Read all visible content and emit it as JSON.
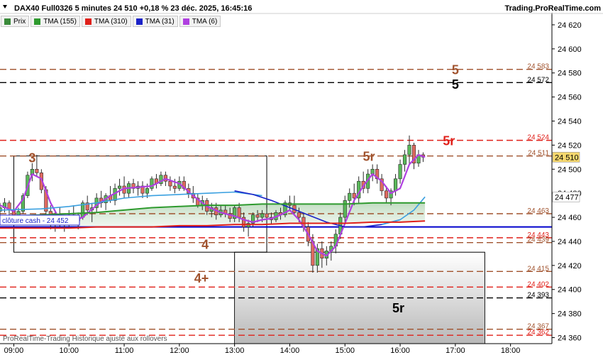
{
  "header": {
    "title": "DAX40 Full0326 5 minutes 24 510 +0,18 % 23 déc. 2025, 16:45:16",
    "brand": "Trading.ProRealTime.com"
  },
  "legend": [
    {
      "label": "Prix",
      "color": "#3a8a3a"
    },
    {
      "label": "TMA (155)",
      "color": "#2e9a2e"
    },
    {
      "label": "TMA (310)",
      "color": "#e0201a"
    },
    {
      "label": "TMA (31)",
      "color": "#1a22c8"
    },
    {
      "label": "TMA (6)",
      "color": "#b040e0"
    }
  ],
  "footer": "ProRealTime-Trading Historique ajusté aux rollovers",
  "cloture": {
    "label": "clôture cash -",
    "value": "24 452"
  },
  "chart_data": {
    "type": "candlestick",
    "ylim": [
      24355,
      24630
    ],
    "xlim": [
      "08:45",
      "18:45"
    ],
    "y_ticks": [
      24360,
      24380,
      24400,
      24420,
      24440,
      24460,
      24480,
      24500,
      24520,
      24540,
      24560,
      24580,
      24600,
      24620
    ],
    "y_tick_labels": [
      "24 360",
      "24 380",
      "24 400",
      "24 420",
      "24 440",
      "24 460",
      "24 480",
      "24 500",
      "24 520",
      "24 540",
      "24 560",
      "24 580",
      "24 600",
      "24 620"
    ],
    "x_ticks": [
      "09:00",
      "10:00",
      "11:00",
      "12:00",
      "13:00",
      "14:00",
      "15:00",
      "16:00",
      "17:00",
      "18:00"
    ],
    "levels": [
      {
        "value": 24583,
        "label": "24 583",
        "color": "#a0522d",
        "style": "dash"
      },
      {
        "value": 24572,
        "label": "24 572",
        "color": "#000000",
        "style": "dash"
      },
      {
        "value": 24524,
        "label": "24 524",
        "color": "#e0201a",
        "style": "dash"
      },
      {
        "value": 24511,
        "label": "24 511",
        "color": "#a0522d",
        "style": "dash"
      },
      {
        "value": 24463,
        "label": "24 463",
        "color": "#a0522d",
        "style": "dash"
      },
      {
        "value": 24452,
        "label": "",
        "color": "#0000cc",
        "style": "solid"
      },
      {
        "value": 24443,
        "label": "24 443",
        "color": "#e0201a",
        "style": "dash"
      },
      {
        "value": 24439,
        "label": "24 439",
        "color": "#a0522d",
        "style": "dash"
      },
      {
        "value": 24415,
        "label": "24 415",
        "color": "#a0522d",
        "style": "dash"
      },
      {
        "value": 24402,
        "label": "24 402",
        "color": "#e0201a",
        "style": "dash"
      },
      {
        "value": 24393,
        "label": "24 393",
        "color": "#000000",
        "style": "dash"
      },
      {
        "value": 24367,
        "label": "24 367",
        "color": "#a0522d",
        "style": "dash"
      },
      {
        "value": 24362,
        "label": "24 362",
        "color": "#e0201a",
        "style": "dash"
      }
    ],
    "price_tags": [
      {
        "value": 24510,
        "label": "24 510",
        "bg": "#f5d76e",
        "color": "#000000"
      },
      {
        "value": 24477,
        "label": "24 477",
        "bg": "#ffffff",
        "color": "#3aa0e0"
      }
    ],
    "annotations": [
      {
        "text": "5",
        "time": "17:00",
        "value": 24583,
        "color": "#a0522d"
      },
      {
        "text": "5",
        "time": "17:00",
        "value": 24571,
        "color": "#000000"
      },
      {
        "text": "5r",
        "time": "16:53",
        "value": 24524,
        "color": "#e0201a"
      },
      {
        "text": "5r",
        "time": "15:26",
        "value": 24511,
        "color": "#a0522d"
      },
      {
        "text": "3",
        "time": "09:20",
        "value": 24510,
        "color": "#a0522d"
      },
      {
        "text": "4",
        "time": "12:28",
        "value": 24438,
        "color": "#a0522d"
      },
      {
        "text": "4+",
        "time": "12:24",
        "value": 24410,
        "color": "#a0522d"
      },
      {
        "text": "5r",
        "time": "15:58",
        "value": 24385,
        "color": "#000000"
      }
    ],
    "boxes": [
      {
        "t1": "09:00",
        "t2": "13:35",
        "v1": 24511,
        "v2": 24431
      },
      {
        "t1": "13:00",
        "t2": "17:32",
        "v1": 24431,
        "v2": 24355
      }
    ],
    "candles": [
      {
        "t": "08:45",
        "o": 24465,
        "h": 24472,
        "l": 24460,
        "c": 24468
      },
      {
        "t": "08:50",
        "o": 24468,
        "h": 24476,
        "l": 24464,
        "c": 24472
      },
      {
        "t": "08:55",
        "o": 24472,
        "h": 24474,
        "l": 24462,
        "c": 24466
      },
      {
        "t": "09:00",
        "o": 24466,
        "h": 24470,
        "l": 24458,
        "c": 24460
      },
      {
        "t": "09:05",
        "o": 24460,
        "h": 24468,
        "l": 24456,
        "c": 24465
      },
      {
        "t": "09:10",
        "o": 24465,
        "h": 24480,
        "l": 24463,
        "c": 24478
      },
      {
        "t": "09:15",
        "o": 24478,
        "h": 24498,
        "l": 24476,
        "c": 24495
      },
      {
        "t": "09:20",
        "o": 24495,
        "h": 24505,
        "l": 24490,
        "c": 24500
      },
      {
        "t": "09:25",
        "o": 24500,
        "h": 24512,
        "l": 24494,
        "c": 24497
      },
      {
        "t": "09:30",
        "o": 24497,
        "h": 24500,
        "l": 24480,
        "c": 24483
      },
      {
        "t": "09:35",
        "o": 24483,
        "h": 24486,
        "l": 24462,
        "c": 24465
      },
      {
        "t": "09:40",
        "o": 24465,
        "h": 24470,
        "l": 24450,
        "c": 24455
      },
      {
        "t": "09:45",
        "o": 24455,
        "h": 24466,
        "l": 24448,
        "c": 24462
      },
      {
        "t": "09:50",
        "o": 24462,
        "h": 24468,
        "l": 24452,
        "c": 24456
      },
      {
        "t": "09:55",
        "o": 24456,
        "h": 24462,
        "l": 24448,
        "c": 24458
      },
      {
        "t": "10:00",
        "o": 24458,
        "h": 24466,
        "l": 24452,
        "c": 24462
      },
      {
        "t": "10:05",
        "o": 24462,
        "h": 24470,
        "l": 24454,
        "c": 24457
      },
      {
        "t": "10:10",
        "o": 24457,
        "h": 24464,
        "l": 24450,
        "c": 24460
      },
      {
        "t": "10:15",
        "o": 24460,
        "h": 24474,
        "l": 24458,
        "c": 24472
      },
      {
        "t": "10:20",
        "o": 24472,
        "h": 24478,
        "l": 24462,
        "c": 24466
      },
      {
        "t": "10:25",
        "o": 24466,
        "h": 24472,
        "l": 24456,
        "c": 24468
      },
      {
        "t": "10:30",
        "o": 24468,
        "h": 24480,
        "l": 24464,
        "c": 24476
      },
      {
        "t": "10:35",
        "o": 24476,
        "h": 24482,
        "l": 24468,
        "c": 24472
      },
      {
        "t": "10:40",
        "o": 24472,
        "h": 24480,
        "l": 24466,
        "c": 24478
      },
      {
        "t": "10:45",
        "o": 24478,
        "h": 24486,
        "l": 24472,
        "c": 24474
      },
      {
        "t": "10:50",
        "o": 24474,
        "h": 24488,
        "l": 24470,
        "c": 24484
      },
      {
        "t": "10:55",
        "o": 24484,
        "h": 24492,
        "l": 24478,
        "c": 24486
      },
      {
        "t": "11:00",
        "o": 24486,
        "h": 24494,
        "l": 24476,
        "c": 24480
      },
      {
        "t": "11:05",
        "o": 24480,
        "h": 24490,
        "l": 24476,
        "c": 24488
      },
      {
        "t": "11:10",
        "o": 24488,
        "h": 24492,
        "l": 24480,
        "c": 24484
      },
      {
        "t": "11:15",
        "o": 24484,
        "h": 24490,
        "l": 24478,
        "c": 24486
      },
      {
        "t": "11:20",
        "o": 24486,
        "h": 24490,
        "l": 24476,
        "c": 24480
      },
      {
        "t": "11:25",
        "o": 24480,
        "h": 24488,
        "l": 24476,
        "c": 24484
      },
      {
        "t": "11:30",
        "o": 24484,
        "h": 24494,
        "l": 24482,
        "c": 24492
      },
      {
        "t": "11:35",
        "o": 24492,
        "h": 24496,
        "l": 24484,
        "c": 24488
      },
      {
        "t": "11:40",
        "o": 24488,
        "h": 24498,
        "l": 24486,
        "c": 24495
      },
      {
        "t": "11:45",
        "o": 24495,
        "h": 24498,
        "l": 24486,
        "c": 24490
      },
      {
        "t": "11:50",
        "o": 24490,
        "h": 24494,
        "l": 24482,
        "c": 24486
      },
      {
        "t": "11:55",
        "o": 24486,
        "h": 24492,
        "l": 24480,
        "c": 24484
      },
      {
        "t": "12:00",
        "o": 24484,
        "h": 24494,
        "l": 24482,
        "c": 24490
      },
      {
        "t": "12:05",
        "o": 24490,
        "h": 24494,
        "l": 24482,
        "c": 24484
      },
      {
        "t": "12:10",
        "o": 24484,
        "h": 24488,
        "l": 24476,
        "c": 24480
      },
      {
        "t": "12:15",
        "o": 24480,
        "h": 24486,
        "l": 24472,
        "c": 24476
      },
      {
        "t": "12:20",
        "o": 24476,
        "h": 24480,
        "l": 24468,
        "c": 24470
      },
      {
        "t": "12:25",
        "o": 24470,
        "h": 24478,
        "l": 24466,
        "c": 24474
      },
      {
        "t": "12:30",
        "o": 24474,
        "h": 24476,
        "l": 24462,
        "c": 24465
      },
      {
        "t": "12:35",
        "o": 24465,
        "h": 24472,
        "l": 24460,
        "c": 24468
      },
      {
        "t": "12:40",
        "o": 24468,
        "h": 24472,
        "l": 24458,
        "c": 24462
      },
      {
        "t": "12:45",
        "o": 24462,
        "h": 24470,
        "l": 24460,
        "c": 24466
      },
      {
        "t": "12:50",
        "o": 24466,
        "h": 24470,
        "l": 24460,
        "c": 24463
      },
      {
        "t": "12:55",
        "o": 24463,
        "h": 24468,
        "l": 24456,
        "c": 24459
      },
      {
        "t": "13:00",
        "o": 24459,
        "h": 24470,
        "l": 24456,
        "c": 24468
      },
      {
        "t": "13:05",
        "o": 24468,
        "h": 24472,
        "l": 24456,
        "c": 24460
      },
      {
        "t": "13:10",
        "o": 24460,
        "h": 24464,
        "l": 24448,
        "c": 24452
      },
      {
        "t": "13:15",
        "o": 24452,
        "h": 24458,
        "l": 24444,
        "c": 24455
      },
      {
        "t": "13:20",
        "o": 24455,
        "h": 24464,
        "l": 24452,
        "c": 24462
      },
      {
        "t": "13:25",
        "o": 24462,
        "h": 24466,
        "l": 24456,
        "c": 24460
      },
      {
        "t": "13:30",
        "o": 24460,
        "h": 24466,
        "l": 24456,
        "c": 24463
      },
      {
        "t": "13:35",
        "o": 24463,
        "h": 24468,
        "l": 24458,
        "c": 24460
      },
      {
        "t": "13:40",
        "o": 24460,
        "h": 24464,
        "l": 24454,
        "c": 24458
      },
      {
        "t": "13:45",
        "o": 24458,
        "h": 24466,
        "l": 24456,
        "c": 24464
      },
      {
        "t": "13:50",
        "o": 24464,
        "h": 24468,
        "l": 24458,
        "c": 24462
      },
      {
        "t": "13:55",
        "o": 24462,
        "h": 24474,
        "l": 24460,
        "c": 24472
      },
      {
        "t": "14:00",
        "o": 24472,
        "h": 24478,
        "l": 24466,
        "c": 24470
      },
      {
        "t": "14:05",
        "o": 24470,
        "h": 24478,
        "l": 24462,
        "c": 24464
      },
      {
        "t": "14:10",
        "o": 24464,
        "h": 24468,
        "l": 24456,
        "c": 24460
      },
      {
        "t": "14:15",
        "o": 24460,
        "h": 24464,
        "l": 24448,
        "c": 24452
      },
      {
        "t": "14:20",
        "o": 24452,
        "h": 24456,
        "l": 24436,
        "c": 24440
      },
      {
        "t": "14:25",
        "o": 24440,
        "h": 24446,
        "l": 24414,
        "c": 24420
      },
      {
        "t": "14:30",
        "o": 24420,
        "h": 24438,
        "l": 24414,
        "c": 24434
      },
      {
        "t": "14:35",
        "o": 24434,
        "h": 24440,
        "l": 24418,
        "c": 24426
      },
      {
        "t": "14:40",
        "o": 24426,
        "h": 24436,
        "l": 24420,
        "c": 24432
      },
      {
        "t": "14:45",
        "o": 24432,
        "h": 24440,
        "l": 24424,
        "c": 24436
      },
      {
        "t": "14:50",
        "o": 24436,
        "h": 24450,
        "l": 24430,
        "c": 24446
      },
      {
        "t": "14:55",
        "o": 24446,
        "h": 24464,
        "l": 24442,
        "c": 24460
      },
      {
        "t": "15:00",
        "o": 24460,
        "h": 24478,
        "l": 24456,
        "c": 24474
      },
      {
        "t": "15:05",
        "o": 24474,
        "h": 24484,
        "l": 24468,
        "c": 24480
      },
      {
        "t": "15:10",
        "o": 24480,
        "h": 24488,
        "l": 24470,
        "c": 24476
      },
      {
        "t": "15:15",
        "o": 24476,
        "h": 24494,
        "l": 24472,
        "c": 24490
      },
      {
        "t": "15:20",
        "o": 24490,
        "h": 24498,
        "l": 24480,
        "c": 24484
      },
      {
        "t": "15:25",
        "o": 24484,
        "h": 24500,
        "l": 24480,
        "c": 24496
      },
      {
        "t": "15:30",
        "o": 24496,
        "h": 24504,
        "l": 24490,
        "c": 24500
      },
      {
        "t": "15:35",
        "o": 24500,
        "h": 24504,
        "l": 24488,
        "c": 24492
      },
      {
        "t": "15:40",
        "o": 24492,
        "h": 24496,
        "l": 24478,
        "c": 24482
      },
      {
        "t": "15:45",
        "o": 24482,
        "h": 24486,
        "l": 24472,
        "c": 24476
      },
      {
        "t": "15:50",
        "o": 24476,
        "h": 24484,
        "l": 24470,
        "c": 24482
      },
      {
        "t": "15:55",
        "o": 24482,
        "h": 24496,
        "l": 24478,
        "c": 24492
      },
      {
        "t": "16:00",
        "o": 24492,
        "h": 24508,
        "l": 24488,
        "c": 24504
      },
      {
        "t": "16:05",
        "o": 24504,
        "h": 24516,
        "l": 24498,
        "c": 24512
      },
      {
        "t": "16:10",
        "o": 24512,
        "h": 24528,
        "l": 24504,
        "c": 24520
      },
      {
        "t": "16:15",
        "o": 24520,
        "h": 24522,
        "l": 24500,
        "c": 24505
      },
      {
        "t": "16:20",
        "o": 24505,
        "h": 24516,
        "l": 24502,
        "c": 24512
      },
      {
        "t": "16:25",
        "o": 24512,
        "h": 24514,
        "l": 24506,
        "c": 24510
      }
    ],
    "series": [
      {
        "name": "TMA (6)",
        "color": "#b040e0",
        "width": 2.2,
        "x": [
          "08:45",
          "09:00",
          "09:10",
          "09:20",
          "09:30",
          "09:40",
          "09:50",
          "10:00",
          "10:15",
          "10:30",
          "10:45",
          "11:00",
          "11:15",
          "11:30",
          "11:45",
          "12:00",
          "12:15",
          "12:30",
          "12:45",
          "13:00",
          "13:10",
          "13:20",
          "13:30",
          "13:40",
          "13:50",
          "14:00",
          "14:10",
          "14:20",
          "14:30",
          "14:40",
          "14:50",
          "15:00",
          "15:10",
          "15:20",
          "15:30",
          "15:40",
          "15:50",
          "16:00",
          "16:10",
          "16:20",
          "16:27"
        ],
        "y": [
          24470,
          24465,
          24475,
          24496,
          24492,
          24472,
          24458,
          24456,
          24460,
          24470,
          24478,
          24484,
          24485,
          24486,
          24492,
          24488,
          24478,
          24469,
          24464,
          24461,
          24458,
          24456,
          24458,
          24459,
          24462,
          24466,
          24458,
          24446,
          24432,
          24428,
          24436,
          24455,
          24474,
          24486,
          24496,
          24490,
          24480,
          24484,
          24504,
          24512,
          24510
        ]
      },
      {
        "name": "TMA (31)",
        "color": "#3aa0e0",
        "width": 1.6,
        "x": [
          "08:45",
          "09:30",
          "10:00",
          "10:30",
          "11:00",
          "11:30",
          "12:00",
          "12:30",
          "13:00",
          "13:30"
        ],
        "y": [
          24466,
          24467,
          24469,
          24472,
          24476,
          24478,
          24479,
          24480,
          24481,
          24478
        ]
      },
      {
        "name": "TMA (31) dark",
        "color": "#1a22c8",
        "width": 1.6,
        "x": [
          "13:00",
          "13:20",
          "13:40",
          "14:00",
          "14:20",
          "14:40",
          "15:00",
          "15:20",
          "15:40",
          "16:00"
        ],
        "y": [
          24482,
          24479,
          24474,
          24468,
          24462,
          24456,
          24452,
          24452,
          24454,
          24458
        ]
      },
      {
        "name": "TMA (31) light",
        "color": "#3aa0e0",
        "width": 1.6,
        "x": [
          "15:40",
          "16:00",
          "16:15",
          "16:27"
        ],
        "y": [
          24454,
          24458,
          24466,
          24477
        ]
      },
      {
        "name": "TMA (155)",
        "color": "#2e9a2e",
        "width": 2.0,
        "x": [
          "08:45",
          "09:30",
          "10:00",
          "10:30",
          "11:00",
          "11:30",
          "12:00",
          "12:30",
          "13:00",
          "13:30",
          "14:00",
          "14:30",
          "15:00",
          "15:30",
          "16:00",
          "16:27"
        ],
        "y": [
          24461,
          24462,
          24463,
          24464,
          24466,
          24468,
          24469,
          24470,
          24470,
          24471,
          24471,
          24471,
          24471,
          24472,
          24472,
          24472
        ]
      },
      {
        "name": "TMA (310)",
        "color": "#e0201a",
        "width": 2.0,
        "x": [
          "08:45",
          "09:30",
          "10:00",
          "10:30",
          "11:00",
          "11:30",
          "12:00",
          "12:30",
          "13:00",
          "13:30",
          "14:00",
          "14:30",
          "15:00",
          "15:30",
          "16:00",
          "16:27"
        ],
        "y": [
          24451,
          24451,
          24451,
          24452,
          24452,
          24452,
          24453,
          24453,
          24454,
          24454,
          24455,
          24455,
          24455,
          24456,
          24456,
          24457
        ]
      }
    ]
  }
}
